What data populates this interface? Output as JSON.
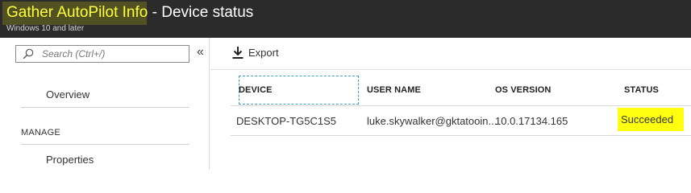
{
  "header": {
    "title_highlight": "Gather AutoPilot Info",
    "title_rest": " - Device status",
    "subtitle": "Windows 10 and later"
  },
  "sidebar": {
    "search_placeholder": "Search (Ctrl+/)",
    "collapse_glyph": "«",
    "items": [
      {
        "label": "Overview"
      },
      {
        "label": "Properties"
      }
    ],
    "section_label": "MANAGE"
  },
  "toolbar": {
    "export_label": "Export"
  },
  "table": {
    "columns": [
      "DEVICE",
      "USER NAME",
      "OS VERSION",
      "STATUS"
    ],
    "rows": [
      {
        "device": "DESKTOP-TG5C1S5",
        "user_name": "luke.skywalker@gktatooin...",
        "os_version": "10.0.17134.165",
        "status": "Succeeded"
      }
    ]
  },
  "colors": {
    "header_bg": "#2b2b2b",
    "title_highlight": "#ffff3a",
    "status_highlight": "#ffff10"
  }
}
